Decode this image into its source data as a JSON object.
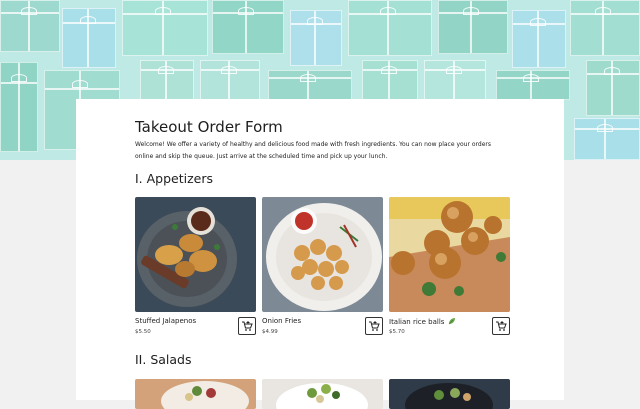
{
  "form": {
    "title": "Takeout Order Form",
    "intro": "Welcome! We offer a variety of healthy and delicious food made with fresh ingredients. You can now place your orders online and skip the queue. Just arrive at the scheduled time and pick up your lunch."
  },
  "sections": [
    {
      "heading": "I. Appetizers",
      "items": [
        {
          "name": "Stuffed Jalapenos",
          "price": "$5.50"
        },
        {
          "name": "Onion Fries",
          "price": "$4.99"
        },
        {
          "name": "Italian rice balls",
          "price": "$5.70",
          "badge_icon": "leaf-icon"
        }
      ]
    },
    {
      "heading": "II. Salads",
      "items": []
    }
  ],
  "icons": {
    "cart": "add-to-cart-icon"
  },
  "colors": {
    "banner": "#bfe9e4",
    "page_bg": "#f1f1f1",
    "card_bg": "#ffffff",
    "leaf": "#6aa84f"
  }
}
